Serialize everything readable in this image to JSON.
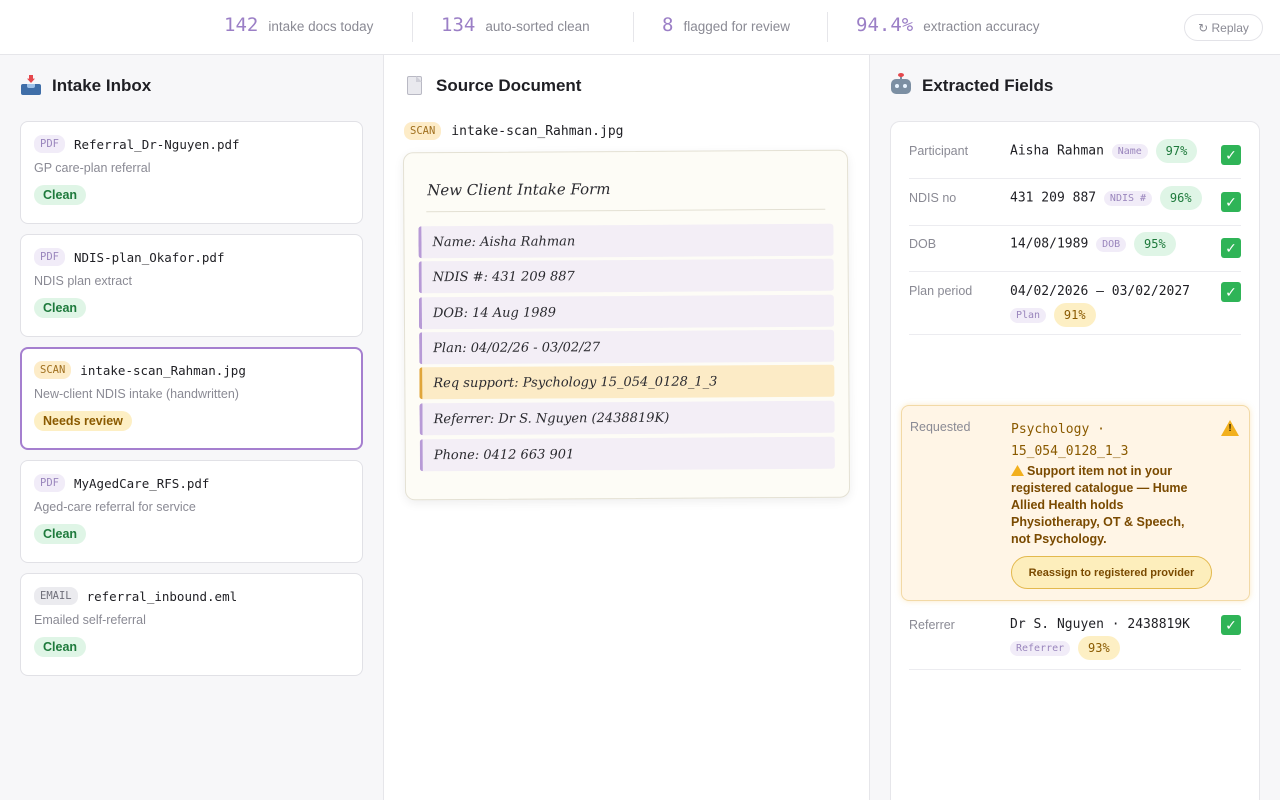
{
  "stats": [
    {
      "value": "142",
      "label": "intake docs today"
    },
    {
      "value": "134",
      "label": "auto-sorted clean"
    },
    {
      "value": "8",
      "label": "flagged for review"
    },
    {
      "value": "94.4%",
      "label": "extraction accuracy"
    }
  ],
  "replay_label": "↻ Replay",
  "inbox": {
    "title": "Intake Inbox",
    "icon": "inbox-tray-icon",
    "cards": [
      {
        "type": "PDF",
        "file": "Referral_Dr-Nguyen.pdf",
        "desc": "GP care-plan referral",
        "status": "Clean",
        "selected": false
      },
      {
        "type": "PDF",
        "file": "NDIS-plan_Okafor.pdf",
        "desc": "NDIS plan extract",
        "status": "Clean",
        "selected": false
      },
      {
        "type": "SCAN",
        "file": "intake-scan_Rahman.jpg",
        "desc": "New-client NDIS intake (handwritten)",
        "status": "Needs review",
        "selected": true
      },
      {
        "type": "PDF",
        "file": "MyAgedCare_RFS.pdf",
        "desc": "Aged-care referral for service",
        "status": "Clean",
        "selected": false
      },
      {
        "type": "EMAIL",
        "file": "referral_inbound.eml",
        "desc": "Emailed self-referral",
        "status": "Clean",
        "selected": false
      }
    ]
  },
  "source": {
    "title": "Source Document",
    "icon": "document-icon",
    "file_type": "SCAN",
    "file_name": "intake-scan_Rahman.jpg",
    "form_title": "New Client Intake Form",
    "lines": [
      "Name: Aisha Rahman",
      "NDIS #: 431 209 887",
      "DOB: 14 Aug 1989",
      "Plan: 04/02/26 - 03/02/27",
      "Req support: Psychology 15_054_0128_1_3",
      "Referrer: Dr S. Nguyen (2438819K)",
      "Phone: 0412 663 901"
    ],
    "flagged_line": 4
  },
  "fields": {
    "title": "Extracted Fields",
    "icon": "robot-icon",
    "rows": [
      {
        "label": "Participant",
        "value": "Aisha Rahman",
        "tag": "Name",
        "confidence": "97%",
        "status": "ok"
      },
      {
        "label": "NDIS no",
        "value": "431 209 887",
        "tag": "NDIS #",
        "confidence": "96%",
        "status": "ok"
      },
      {
        "label": "DOB",
        "value": "14/08/1989",
        "tag": "DOB",
        "confidence": "95%",
        "status": "ok"
      },
      {
        "label": "Plan period",
        "value": "04/02/2026 – 03/02/2027",
        "tag": "Plan",
        "confidence": "91%",
        "status": "ok"
      },
      {
        "label": "Referrer",
        "value": "Dr S. Nguyen · 2438819K",
        "tag": "Referrer",
        "confidence": "93%",
        "status": "ok"
      }
    ],
    "requested": {
      "label": "Requested",
      "value_line1": "Psychology ·",
      "value_line2": "15_054_0128_1_3",
      "warning": "Support item not in your registered catalogue — Hume Allied Health holds Physiotherapy, OT & Speech, not Psychology.",
      "action": "Reassign to registered provider"
    }
  },
  "colors": {
    "accent": "#9b7fc6",
    "clean_bg": "#dff5e6",
    "clean_text": "#1e7a3c",
    "review_bg": "#fdefc4",
    "review_text": "#8a5a00",
    "check": "#2fb457",
    "warning": "#f2b01e"
  }
}
